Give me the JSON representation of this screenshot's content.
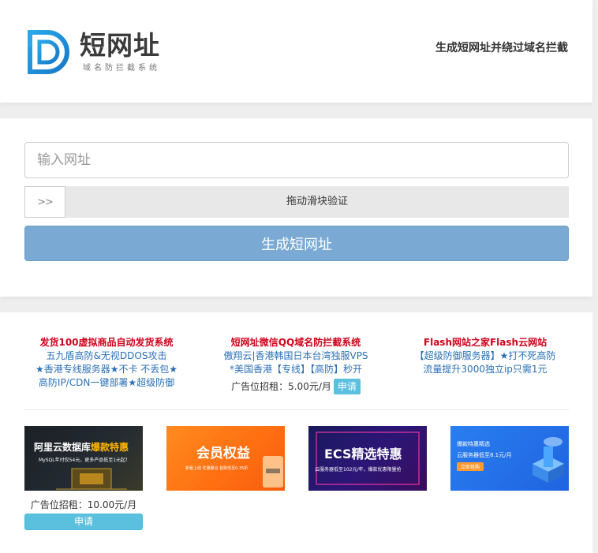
{
  "header": {
    "logo_title": "短网址",
    "logo_subtitle": "域名防拦截系统",
    "slogan": "生成短网址并绕过域名拦截"
  },
  "form": {
    "url_placeholder": "输入网址",
    "slider_handle_glyph": ">>",
    "slider_text": "拖动滑块验证",
    "generate_label": "生成短网址"
  },
  "text_ads": [
    {
      "title": "发货100虚拟商品自动发货系统",
      "lines": [
        "五九盾高防&无视DDOS攻击",
        "★香港专线服务器★不卡 不丢包★",
        "高防IP/CDN一键部署★超级防御"
      ]
    },
    {
      "title": "短网址微信QQ域名防拦截系统",
      "lines": [
        "傲翔云|香港韩国日本台湾独服VPS",
        "*美国香港【专线】【高防】秒开"
      ],
      "price": "广告位招租：5.00元/月",
      "apply": "申请"
    },
    {
      "title": "Flash网站之家Flash云网站",
      "lines": [
        "【超级防御服务器】★打不死高防",
        "流量提升3000独立ip只需1元"
      ]
    }
  ],
  "banners": [
    {
      "title": "阿里云数据库",
      "highlight": "爆款特惠",
      "sub": "MySQL年付仅54元，更多产品低至1元起！"
    },
    {
      "title": "会员权益",
      "sub": "新租上线 优惠聚合 首购低至0.35折"
    },
    {
      "title": "ECS精选特惠",
      "sub": "云服务器低至102元/年，爆款优惠限量抢"
    },
    {
      "title": "爆款特惠精选",
      "sub": "云服务器低至8.1元/月",
      "button": "立即抢购"
    }
  ],
  "banner_ad": {
    "price": "广告位招租：10.00元/月",
    "apply": "申请"
  },
  "colors": {
    "primary_button": "#7aaad3",
    "apply_button": "#5bc0de",
    "ad_title": "#d0021b",
    "ad_link": "#2a6fb5"
  }
}
